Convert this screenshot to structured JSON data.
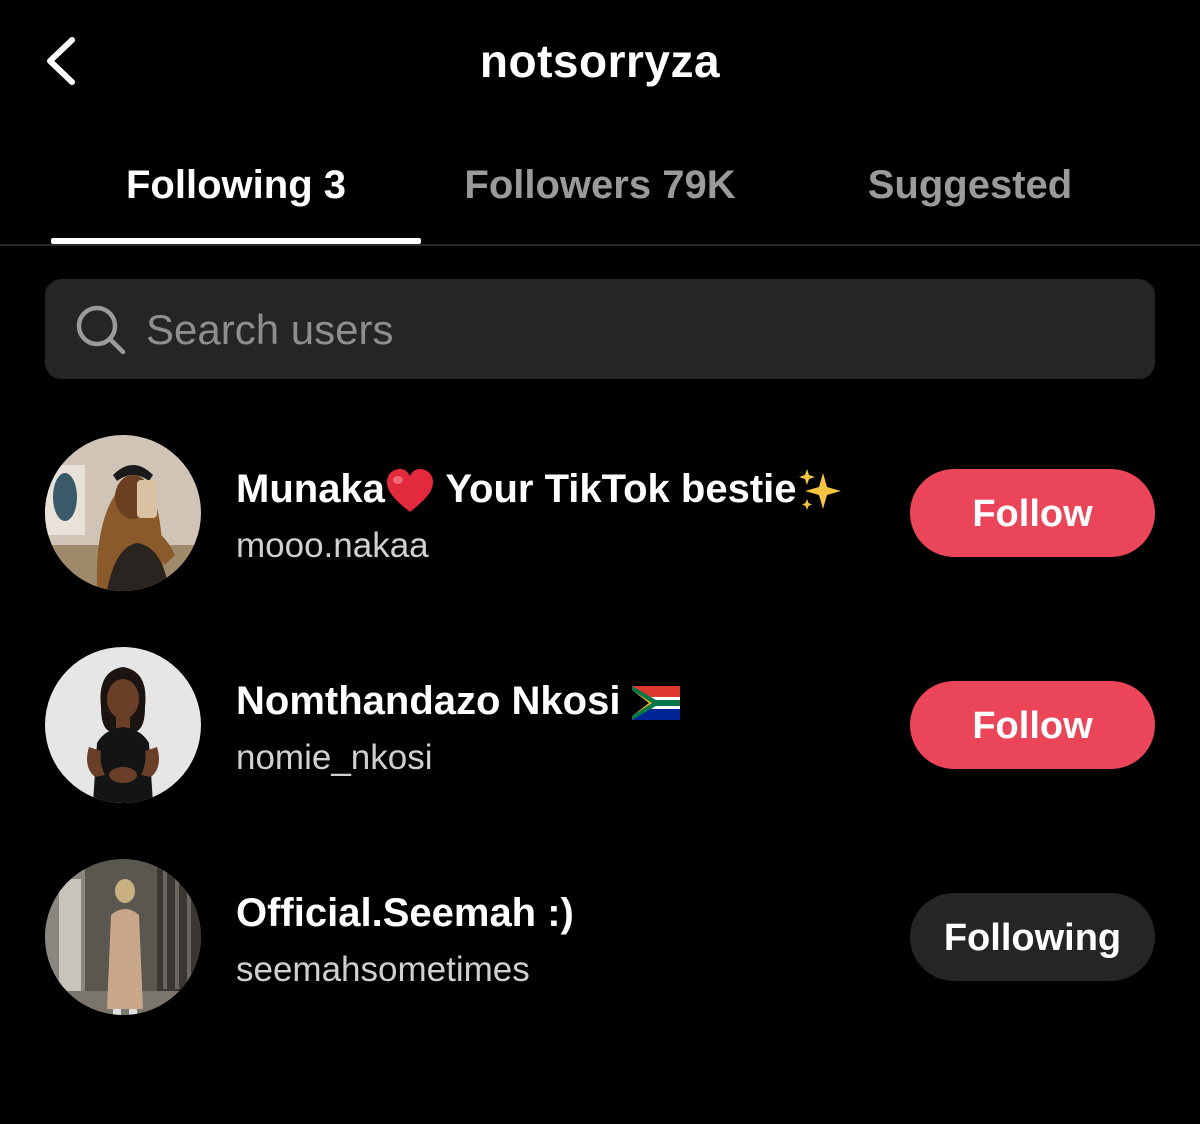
{
  "header": {
    "title": "notsorryza",
    "back_icon": "chevron-left-icon"
  },
  "tabs": [
    {
      "label": "Following 3",
      "active": true
    },
    {
      "label": "Followers 79K",
      "active": false
    },
    {
      "label": "Suggested",
      "active": false
    }
  ],
  "search": {
    "placeholder": "Search users",
    "value": "",
    "icon": "search-icon"
  },
  "users": [
    {
      "display_name_part1": "Munaka",
      "emoji1": "red-heart",
      "display_name_part2": " Your TikTok bestie",
      "emoji2": "sparkles",
      "username": "mooo.nakaa",
      "button": "Follow",
      "button_state": "follow"
    },
    {
      "display_name_part1": "Nomthandazo Nkosi ",
      "emoji1": "south-africa-flag",
      "username": "nomie_nkosi",
      "button": "Follow",
      "button_state": "follow"
    },
    {
      "display_name_part1": "Official.Seemah :)",
      "username": "seemahsometimes",
      "button": "Following",
      "button_state": "following"
    }
  ],
  "colors": {
    "background": "#000000",
    "follow_button": "#ea4559",
    "following_button": "#252525",
    "search_bg": "#252525",
    "inactive_tab": "#9a9a9a"
  }
}
